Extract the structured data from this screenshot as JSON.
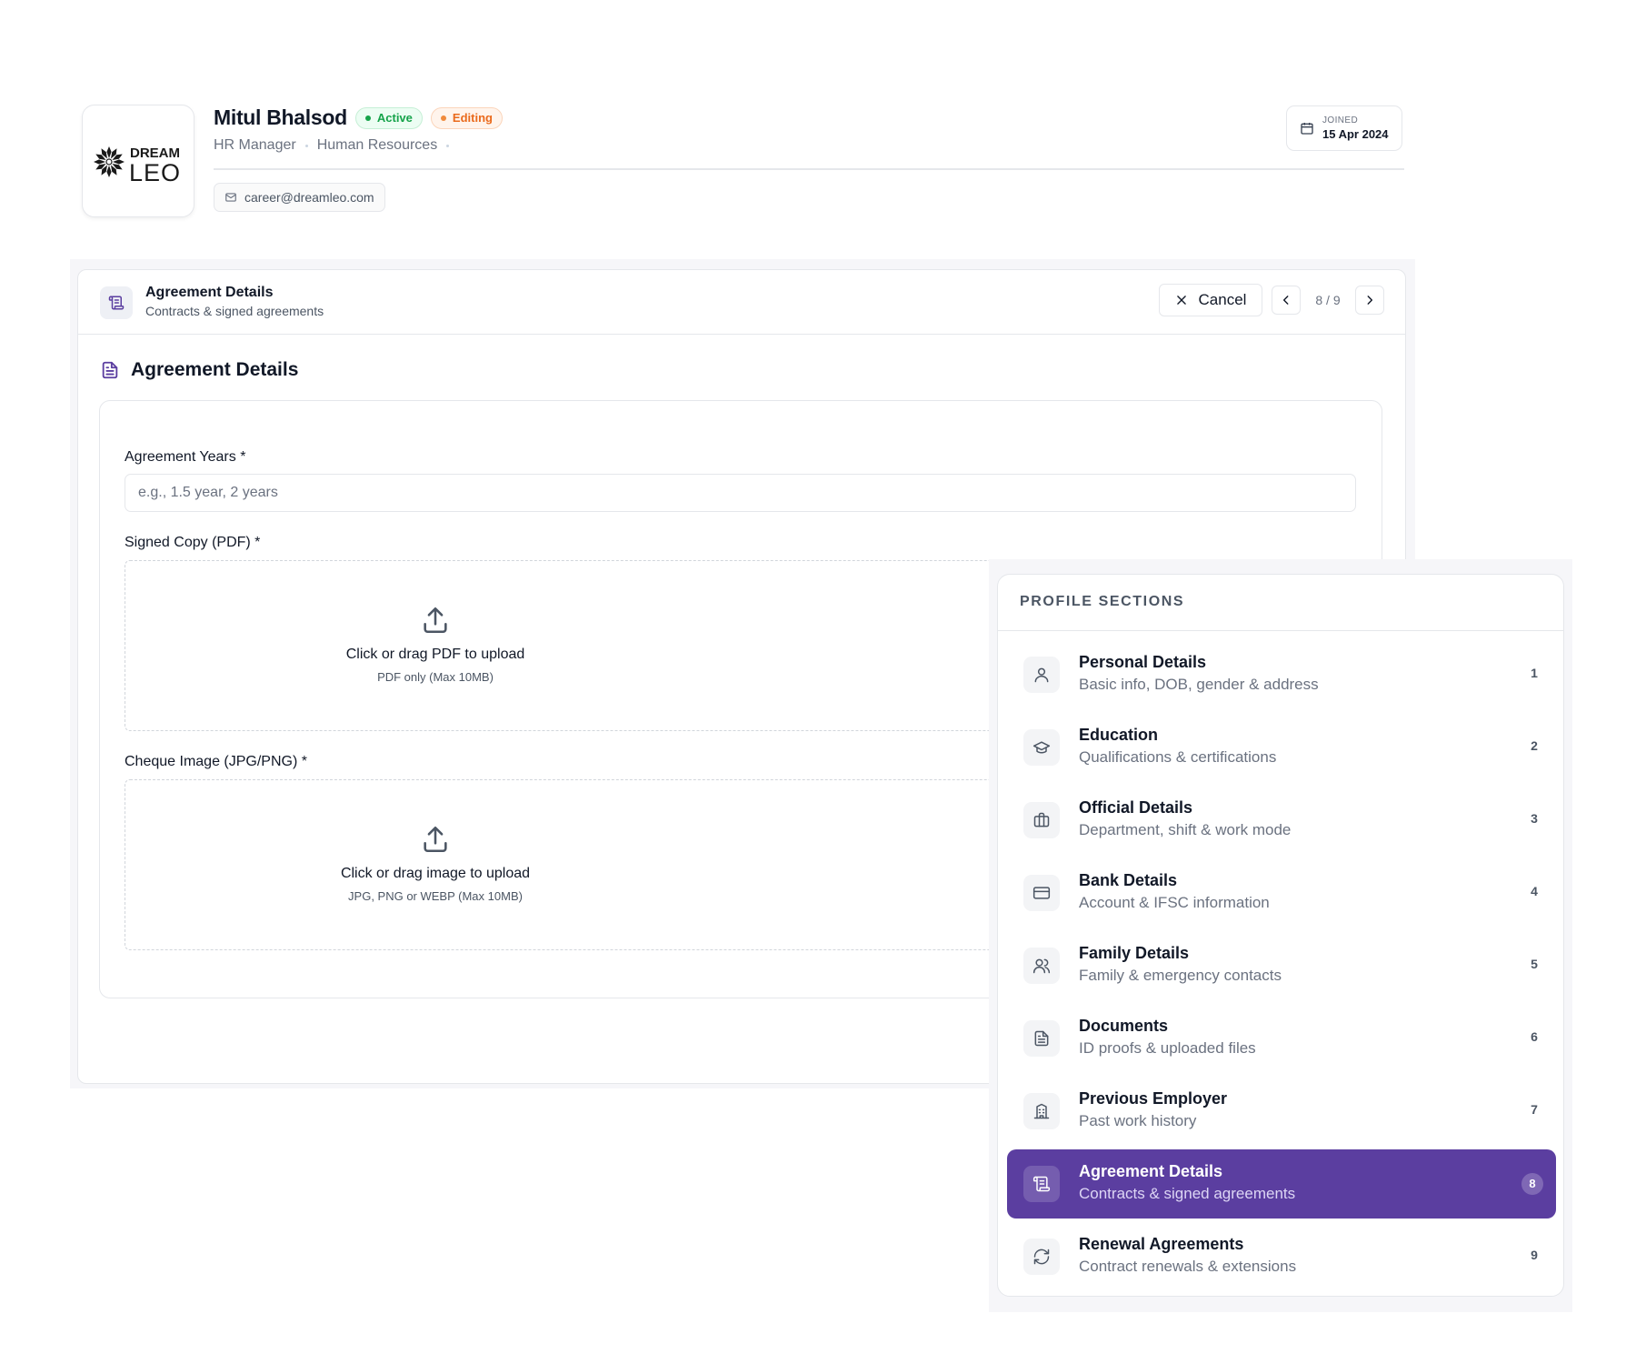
{
  "header": {
    "logo": {
      "word_top": "DREAM",
      "word_bottom": "LEO"
    },
    "name": "Mitul Bhalsod",
    "status_badge": "Active",
    "mode_badge": "Editing",
    "role": "HR Manager",
    "department": "Human Resources",
    "email": "career@dreamleo.com",
    "joined_label": "JOINED",
    "joined_date": "15 Apr 2024"
  },
  "panel": {
    "title": "Agreement Details",
    "subtitle": "Contracts & signed agreements",
    "cancel_label": "Cancel",
    "pager": "8 / 9"
  },
  "form": {
    "heading": "Agreement Details",
    "agreement_years": {
      "label": "Agreement Years",
      "required": "*",
      "placeholder": "e.g., 1.5 year, 2 years",
      "value": ""
    },
    "signed_copy": {
      "label": "Signed Copy (PDF)",
      "required": "*",
      "title": "Click or drag PDF to upload",
      "hint": "PDF only (Max 10MB)"
    },
    "cheque_image": {
      "label": "Cheque Image (JPG/PNG)",
      "required": "*",
      "title": "Click or drag image to upload",
      "hint": "JPG, PNG or WEBP (Max 10MB)"
    }
  },
  "profile_sections": {
    "heading": "PROFILE SECTIONS",
    "active_index": 7,
    "items": [
      {
        "title": "Personal Details",
        "desc": "Basic info, DOB, gender & address",
        "num": "1",
        "icon": "user-icon"
      },
      {
        "title": "Education",
        "desc": "Qualifications & certifications",
        "num": "2",
        "icon": "graduation-cap-icon"
      },
      {
        "title": "Official Details",
        "desc": "Department, shift & work mode",
        "num": "3",
        "icon": "briefcase-icon"
      },
      {
        "title": "Bank Details",
        "desc": "Account & IFSC information",
        "num": "4",
        "icon": "credit-card-icon"
      },
      {
        "title": "Family Details",
        "desc": "Family & emergency contacts",
        "num": "5",
        "icon": "users-icon"
      },
      {
        "title": "Documents",
        "desc": "ID proofs & uploaded files",
        "num": "6",
        "icon": "file-text-icon"
      },
      {
        "title": "Previous Employer",
        "desc": "Past work history",
        "num": "7",
        "icon": "building-icon"
      },
      {
        "title": "Agreement Details",
        "desc": "Contracts & signed agreements",
        "num": "8",
        "icon": "scroll-icon"
      },
      {
        "title": "Renewal Agreements",
        "desc": "Contract renewals & extensions",
        "num": "9",
        "icon": "refresh-icon"
      }
    ]
  },
  "colors": {
    "accent": "#5b3ea0",
    "active_green": "#16a34a",
    "editing_orange": "#ea6a1c"
  }
}
